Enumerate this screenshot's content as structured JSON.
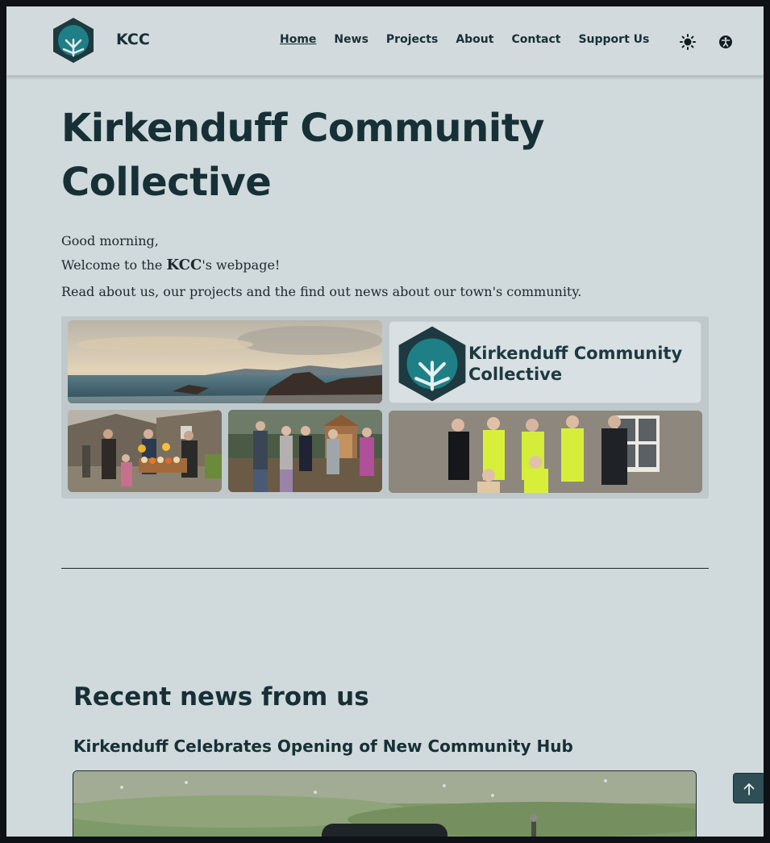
{
  "header": {
    "brand": "KCC",
    "nav": [
      {
        "label": "Home",
        "active": true
      },
      {
        "label": "News",
        "active": false
      },
      {
        "label": "Projects",
        "active": false
      },
      {
        "label": "About",
        "active": false
      },
      {
        "label": "Contact",
        "active": false
      },
      {
        "label": "Support Us",
        "active": false
      }
    ],
    "icons": [
      "sun-icon",
      "accessibility-icon"
    ]
  },
  "hero": {
    "title_line1": "Kirkenduff Community",
    "title_line2": "Collective",
    "greeting": "Good morning,",
    "welcome_prefix": "Welcome to the ",
    "welcome_strong": "KCC",
    "welcome_suffix": "'s webpage!",
    "description": "Read about us, our projects and the find out news about our town's community."
  },
  "gallery": {
    "logo_text_line1": "Kirkenduff Community",
    "logo_text_line2": "Collective"
  },
  "news": {
    "heading": "Recent news from us",
    "articles": [
      {
        "title": "Kirkenduff Celebrates Opening of New Community Hub"
      }
    ]
  },
  "colors": {
    "background": "#d0d9dc",
    "text": "#163036",
    "accent": "#1f7a80",
    "button": "#2f4e55"
  }
}
